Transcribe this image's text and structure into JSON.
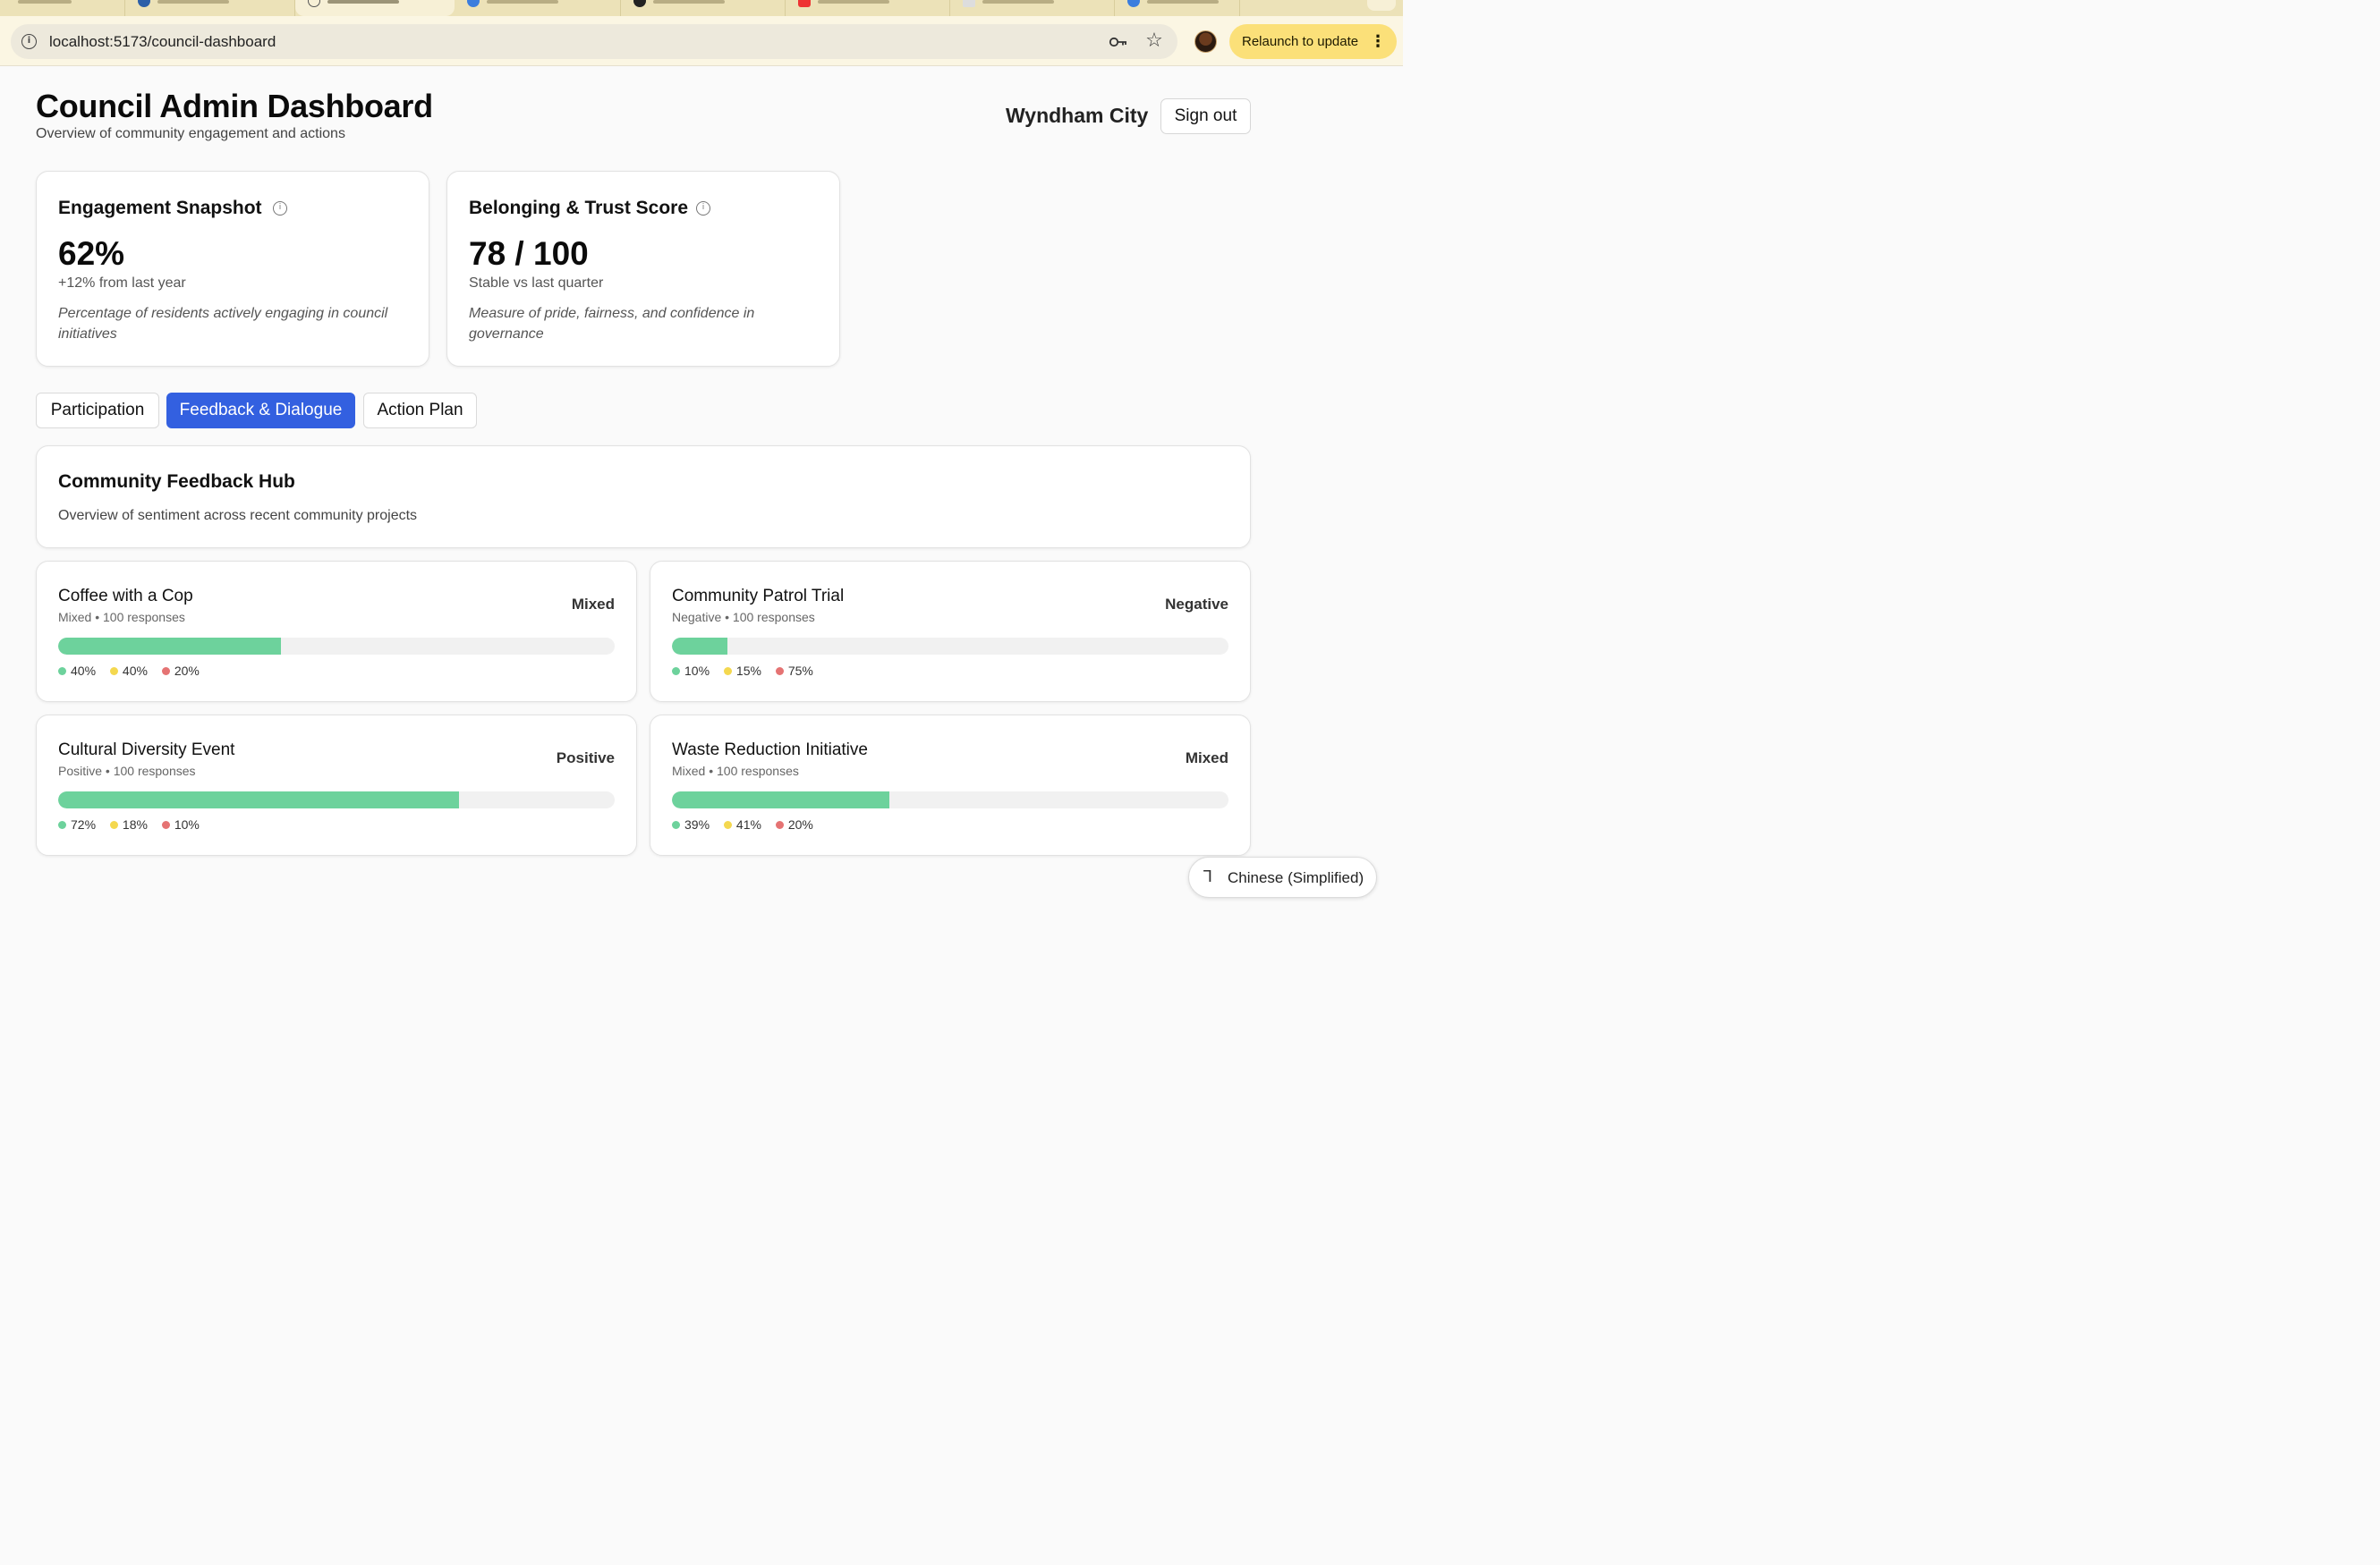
{
  "browser": {
    "url": "localhost:5173/council-dashboard",
    "relaunch_label": "Relaunch to update",
    "menu_icon": "kebab-menu-icon"
  },
  "header": {
    "title": "Council Admin Dashboard",
    "subtitle": "Overview of community engagement and actions",
    "org_name": "Wyndham City",
    "signout_label": "Sign out"
  },
  "stats": [
    {
      "title": "Engagement Snapshot",
      "value": "62%",
      "delta": "+12% from last year",
      "description": "Percentage of residents actively engaging in council initiatives"
    },
    {
      "title": "Belonging & Trust Score",
      "value": "78 / 100",
      "delta": "Stable vs last quarter",
      "description": "Measure of pride, fairness, and confidence in governance"
    }
  ],
  "tabs": [
    {
      "label": "Participation",
      "active": false
    },
    {
      "label": "Feedback & Dialogue",
      "active": true
    },
    {
      "label": "Action Plan",
      "active": false
    }
  ],
  "hub": {
    "title": "Community Feedback Hub",
    "subtitle": "Overview of sentiment across recent community projects"
  },
  "colors": {
    "positive": "#6dd29c",
    "neutral": "#f4d84f",
    "negative": "#e57373",
    "accent": "#3360e0"
  },
  "feedback": [
    {
      "name": "Coffee with a Cop",
      "meta": "Mixed • 100 responses",
      "sentiment": "Mixed",
      "positive_pct": 40,
      "legend": [
        "40%",
        "40%",
        "20%"
      ]
    },
    {
      "name": "Community Patrol Trial",
      "meta": "Negative • 100 responses",
      "sentiment": "Negative",
      "positive_pct": 10,
      "legend": [
        "10%",
        "15%",
        "75%"
      ]
    },
    {
      "name": "Cultural Diversity Event",
      "meta": "Positive • 100 responses",
      "sentiment": "Positive",
      "positive_pct": 72,
      "legend": [
        "72%",
        "18%",
        "10%"
      ]
    },
    {
      "name": "Waste Reduction Initiative",
      "meta": "Mixed • 100 responses",
      "sentiment": "Mixed",
      "positive_pct": 39,
      "legend": [
        "39%",
        "41%",
        "20%"
      ]
    }
  ],
  "translate": {
    "label": "Chinese (Simplified)"
  }
}
